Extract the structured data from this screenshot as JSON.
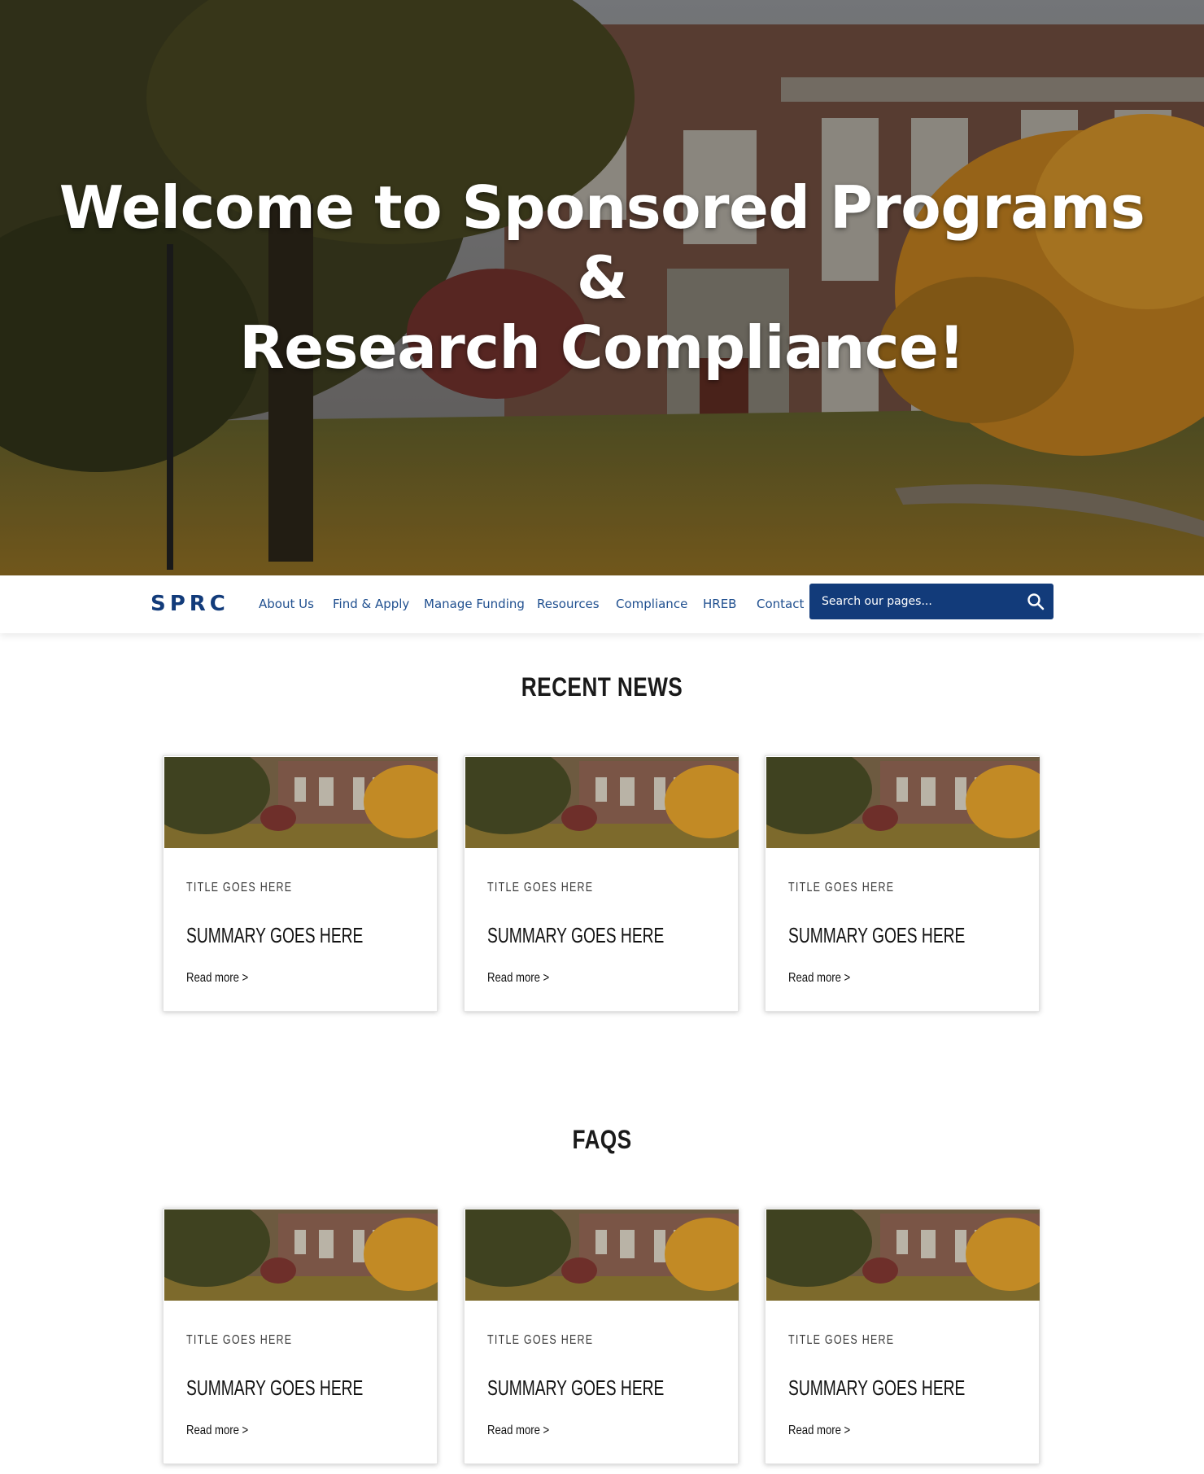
{
  "hero": {
    "title_line1": "Welcome to Sponsored Programs",
    "title_line2": "&",
    "title_line3": "Research Compliance!"
  },
  "nav": {
    "logo": "SPRC",
    "links": [
      "About Us",
      "Find & Apply",
      "Manage Funding",
      "Resources",
      "Compliance",
      "HREB",
      "Contact"
    ],
    "search_placeholder": "Search our pages...",
    "search_icon": "search-icon"
  },
  "news": {
    "heading": "RECENT NEWS",
    "cards": [
      {
        "title": "TITLE GOES HERE",
        "summary": "SUMMARY GOES HERE",
        "link": "Read more >"
      },
      {
        "title": "TITLE GOES HERE",
        "summary": "SUMMARY GOES HERE",
        "link": "Read more >"
      },
      {
        "title": "TITLE GOES HERE",
        "summary": "SUMMARY GOES HERE",
        "link": "Read more >"
      }
    ]
  },
  "faqs": {
    "heading": "FAQS",
    "cards": [
      {
        "title": "TITLE GOES HERE",
        "summary": "SUMMARY GOES HERE",
        "link": "Read more >"
      },
      {
        "title": "TITLE GOES HERE",
        "summary": "SUMMARY GOES HERE",
        "link": "Read more >"
      },
      {
        "title": "TITLE GOES HERE",
        "summary": "SUMMARY GOES HERE",
        "link": "Read more >"
      }
    ]
  },
  "colors": {
    "brand_navy": "#123b7a",
    "nav_link": "#1f4f8f"
  }
}
